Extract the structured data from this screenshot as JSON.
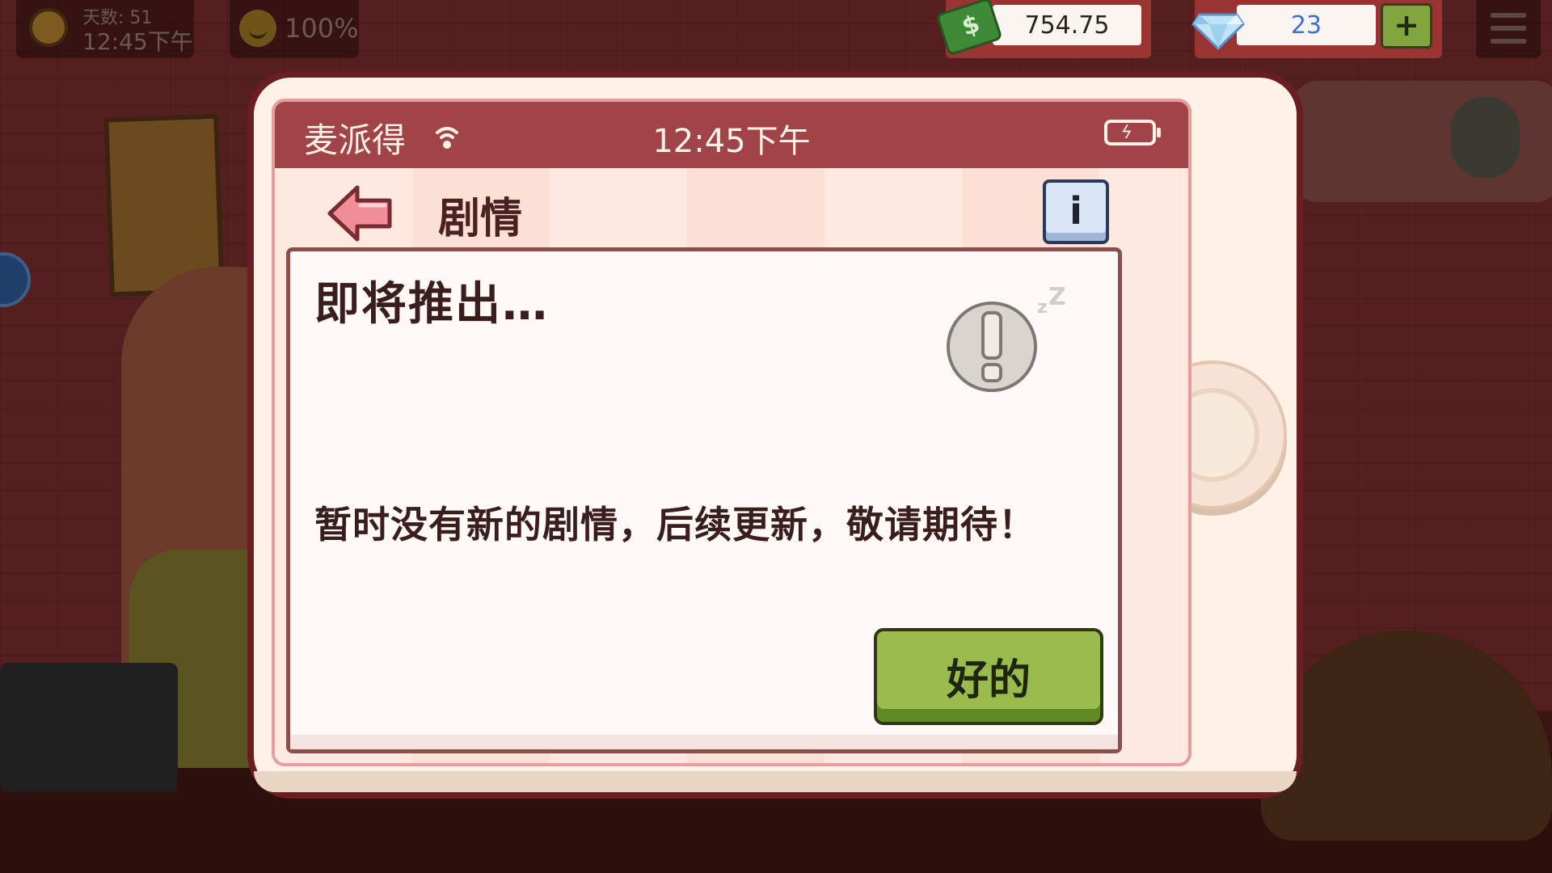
{
  "hud": {
    "day_label": "天数: 51",
    "clock": "12:45下午",
    "mood": "100%",
    "money": "754.75",
    "gems": "23",
    "plus_label": "+"
  },
  "phone": {
    "carrier": "麦派得",
    "time": "12:45下午",
    "nav_title": "剧情",
    "info_label": "i",
    "heading": "即将推出…",
    "message": "暂时没有新的剧情，后续更新，敬请期待！",
    "ok_label": "好的"
  },
  "colors": {
    "status_bar": "#a14447",
    "ok_button": "#9abb4e",
    "phone_frame": "#fef1e6",
    "money_accent": "#3e8a37",
    "gem_text": "#3f6fd0"
  },
  "icons": {
    "back": "arrow-left-icon",
    "info": "info-icon",
    "sleep": "sleeping-exclamation-icon",
    "wifi": "wifi-icon",
    "battery": "battery-charging-icon",
    "money": "cash-icon",
    "gem": "diamond-icon",
    "menu": "hamburger-menu-icon"
  }
}
